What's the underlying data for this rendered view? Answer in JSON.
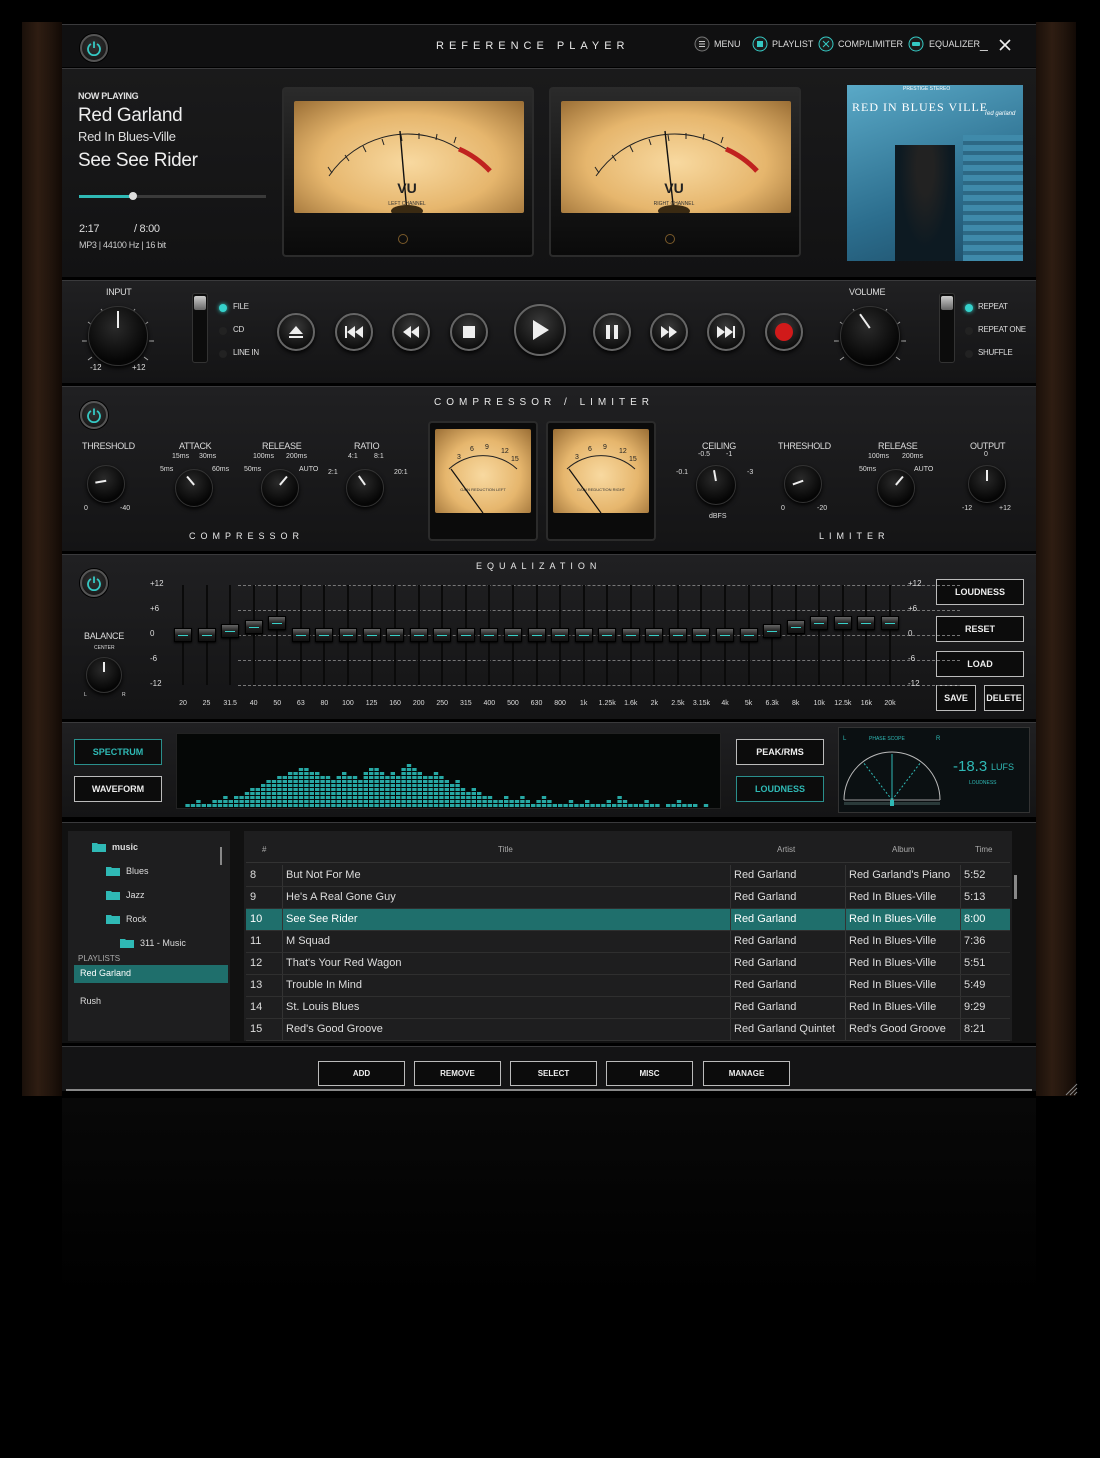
{
  "app": {
    "title": "REFERENCE PLAYER"
  },
  "topnav": {
    "menu": "MENU",
    "playlist": "PLAYLIST",
    "comp": "COMP/LIMITER",
    "eq": "EQUALIZER"
  },
  "now": {
    "heading": "NOW PLAYING",
    "artist": "Red Garland",
    "album": "Red In Blues-Ville",
    "track": "See See Rider",
    "elapsed": "2:17",
    "total": "/ 8:00",
    "format": "MP3 | 44100 Hz | 16 bit",
    "progress": 0.29
  },
  "vu": {
    "left_label": "LEFT CHANNEL",
    "right_label": "RIGHT CHANNEL",
    "vu_text": "VU",
    "scale": [
      "-20",
      "-10",
      "-7",
      "-5",
      "-3",
      "-2",
      "-1",
      "0",
      "+1",
      "+2",
      "+3"
    ],
    "inner": [
      "20",
      "40",
      "60",
      "80",
      "100"
    ]
  },
  "album_art": {
    "label": "PRESTIGE STEREO",
    "title": "RED IN BLUES VILLE",
    "artist": "red garland"
  },
  "transport": {
    "input_label": "INPUT",
    "input_min": "-12",
    "input_max": "+12",
    "sources": [
      "FILE",
      "CD",
      "LINE IN"
    ],
    "volume_label": "VOLUME",
    "modes": [
      "REPEAT",
      "REPEAT ONE",
      "SHUFFLE"
    ]
  },
  "comp": {
    "title": "COMPRESSOR / LIMITER",
    "threshold": "THRESHOLD",
    "th_min": "0",
    "th_max": "-40",
    "attack": "ATTACK",
    "att_a": "15ms",
    "att_b": "30ms",
    "att_c": "5ms",
    "att_d": "60ms",
    "release": "RELEASE",
    "rel_a": "100ms",
    "rel_b": "200ms",
    "rel_c": "50ms",
    "rel_d": "AUTO",
    "ratio": "RATIO",
    "rat_a": "4:1",
    "rat_b": "8:1",
    "rat_c": "2:1",
    "rat_d": "20:1",
    "section": "COMPRESSOR",
    "meter_scale": [
      "3",
      "6",
      "9",
      "12",
      "15"
    ],
    "meter_left": "GAIN REDUCTION LEFT",
    "meter_right": "GAIN REDUCTION RIGHT",
    "ceiling": "CEILING",
    "ce_a": "-0.5",
    "ce_b": "-1",
    "ce_c": "-0.1",
    "ce_d": "-3",
    "ce_unit": "dBFS",
    "lthreshold": "THRESHOLD",
    "lth_min": "0",
    "lth_max": "-20",
    "lrelease": "RELEASE",
    "lrel_a": "100ms",
    "lrel_b": "200ms",
    "lrel_c": "50ms",
    "lrel_d": "AUTO",
    "output": "OUTPUT",
    "out_top": "0",
    "out_min": "-12",
    "out_max": "+12",
    "lsection": "LIMITER"
  },
  "eq": {
    "title": "EQUALIZATION",
    "balance": "BALANCE",
    "bal_center": "CENTER",
    "bal_l": "L",
    "bal_r": "R",
    "levels": [
      "+12",
      "+6",
      "0",
      "-6",
      "-12"
    ],
    "bands": [
      "20",
      "25",
      "31.5",
      "40",
      "50",
      "63",
      "80",
      "100",
      "125",
      "160",
      "200",
      "250",
      "315",
      "400",
      "500",
      "630",
      "800",
      "1k",
      "1.25k",
      "1.6k",
      "2k",
      "2.5k",
      "3.15k",
      "4k",
      "5k",
      "6.3k",
      "8k",
      "10k",
      "12.5k",
      "16k",
      "20k"
    ],
    "gains": [
      0,
      0,
      1,
      2,
      3,
      0,
      0,
      0,
      0,
      0,
      0,
      0,
      0,
      0,
      0,
      0,
      0,
      0,
      0,
      0,
      0,
      0,
      0,
      0,
      0,
      1,
      2,
      3,
      3,
      3,
      3
    ],
    "buttons": {
      "loudness": "LOUDNESS",
      "reset": "RESET",
      "load": "LOAD",
      "save": "SAVE",
      "delete": "DELETE"
    }
  },
  "analyzer": {
    "spectrum": "SPECTRUM",
    "waveform": "WAVEFORM",
    "peak": "PEAK/RMS",
    "loudness": "LOUDNESS",
    "phase": "PHASE SCOPE",
    "phase_l": "L",
    "phase_r": "R",
    "lufs_value": "-18.3",
    "lufs_unit": "LUFS",
    "lufs_label": "LOUDNESS",
    "levels": [
      0,
      1,
      1,
      2,
      1,
      1,
      2,
      2,
      3,
      2,
      3,
      3,
      4,
      5,
      5,
      6,
      7,
      7,
      8,
      8,
      9,
      9,
      10,
      10,
      9,
      9,
      8,
      8,
      7,
      8,
      9,
      8,
      8,
      7,
      9,
      10,
      10,
      9,
      8,
      9,
      8,
      10,
      11,
      10,
      9,
      8,
      8,
      9,
      8,
      7,
      6,
      7,
      5,
      4,
      5,
      4,
      3,
      3,
      2,
      2,
      3,
      2,
      2,
      3,
      2,
      1,
      2,
      3,
      2,
      1,
      1,
      1,
      2,
      1,
      1,
      2,
      1,
      1,
      1,
      2,
      1,
      3,
      2,
      1,
      1,
      1,
      2,
      1,
      1,
      0,
      1,
      1,
      2,
      1,
      1,
      1,
      0,
      1,
      0,
      0
    ]
  },
  "library": {
    "folders": [
      "music",
      "Blues",
      "Jazz",
      "Rock",
      "311 - Music"
    ],
    "playlists_label": "PLAYLISTS",
    "playlists": [
      "Red Garland",
      "Rush"
    ],
    "columns": [
      "#",
      "Title",
      "Artist",
      "Album",
      "Time"
    ],
    "rows": [
      {
        "n": "8",
        "title": "But Not For Me",
        "artist": "Red Garland",
        "album": "Red Garland's Piano",
        "time": "5:52"
      },
      {
        "n": "9",
        "title": "He's A Real Gone Guy",
        "artist": "Red Garland",
        "album": "Red In Blues-Ville",
        "time": "5:13"
      },
      {
        "n": "10",
        "title": "See See Rider",
        "artist": "Red Garland",
        "album": "Red In Blues-Ville",
        "time": "8:00"
      },
      {
        "n": "11",
        "title": "M Squad",
        "artist": "Red Garland",
        "album": "Red In Blues-Ville",
        "time": "7:36"
      },
      {
        "n": "12",
        "title": "That's Your Red Wagon",
        "artist": "Red Garland",
        "album": "Red In Blues-Ville",
        "time": "5:51"
      },
      {
        "n": "13",
        "title": "Trouble In Mind",
        "artist": "Red Garland",
        "album": "Red In Blues-Ville",
        "time": "5:49"
      },
      {
        "n": "14",
        "title": "St. Louis Blues",
        "artist": "Red Garland",
        "album": "Red In Blues-Ville",
        "time": "9:29"
      },
      {
        "n": "15",
        "title": "Red's Good Groove",
        "artist": "Red Garland Quintet",
        "album": "Red's Good Groove",
        "time": "8:21"
      }
    ],
    "selected_row": 2
  },
  "bottom": {
    "add": "ADD",
    "remove": "REMOVE",
    "select": "SELECT",
    "misc": "MISC",
    "manage": "MANAGE"
  }
}
